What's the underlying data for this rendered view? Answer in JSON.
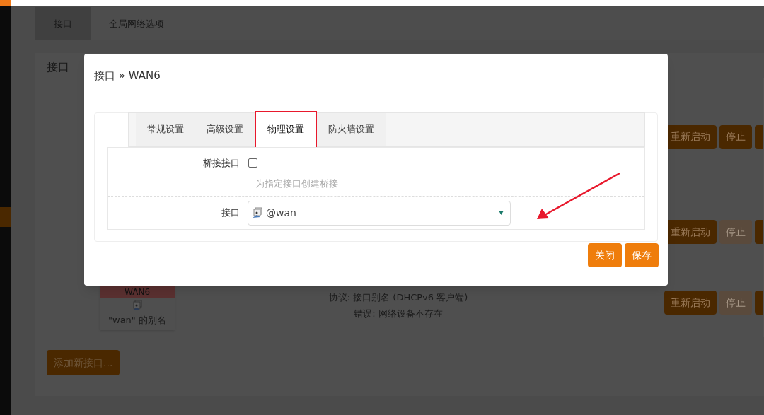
{
  "nav_tabs": [
    {
      "label": "接口",
      "selected": true
    },
    {
      "label": "全局网络选项",
      "selected": false
    }
  ],
  "section_title": "接口",
  "interface_rows": [
    {
      "buttons": [
        {
          "label": "重新启动",
          "disabled": false
        },
        {
          "label": "停止",
          "disabled": false
        }
      ]
    },
    {
      "buttons": [
        {
          "label": "重新启动",
          "disabled": false
        },
        {
          "label": "停止",
          "disabled": true
        }
      ]
    },
    {
      "card": {
        "name": "WAN6",
        "description": "\"wan\" 的别名"
      },
      "protocol": "协议: 接口别名 (DHCPv6 客户端)",
      "error": "错误: 网络设备不存在",
      "buttons": [
        {
          "label": "重新启动",
          "disabled": false
        },
        {
          "label": "停止",
          "disabled": true
        }
      ]
    }
  ],
  "add_button": "添加新接口...",
  "modal": {
    "title": "接口 » WAN6",
    "tabs": [
      {
        "label": "常规设置",
        "selected": false,
        "highlighted": false
      },
      {
        "label": "高级设置",
        "selected": false,
        "highlighted": false
      },
      {
        "label": "物理设置",
        "selected": true,
        "highlighted": true
      },
      {
        "label": "防火墙设置",
        "selected": false,
        "highlighted": false
      }
    ],
    "fields": [
      {
        "kind": "checkbox",
        "label": "桥接接口",
        "checked": false,
        "hint": "为指定接口创建桥接"
      },
      {
        "kind": "select",
        "label": "接口",
        "value": "@wan"
      }
    ],
    "buttons": [
      "关闭",
      "保存"
    ]
  }
}
